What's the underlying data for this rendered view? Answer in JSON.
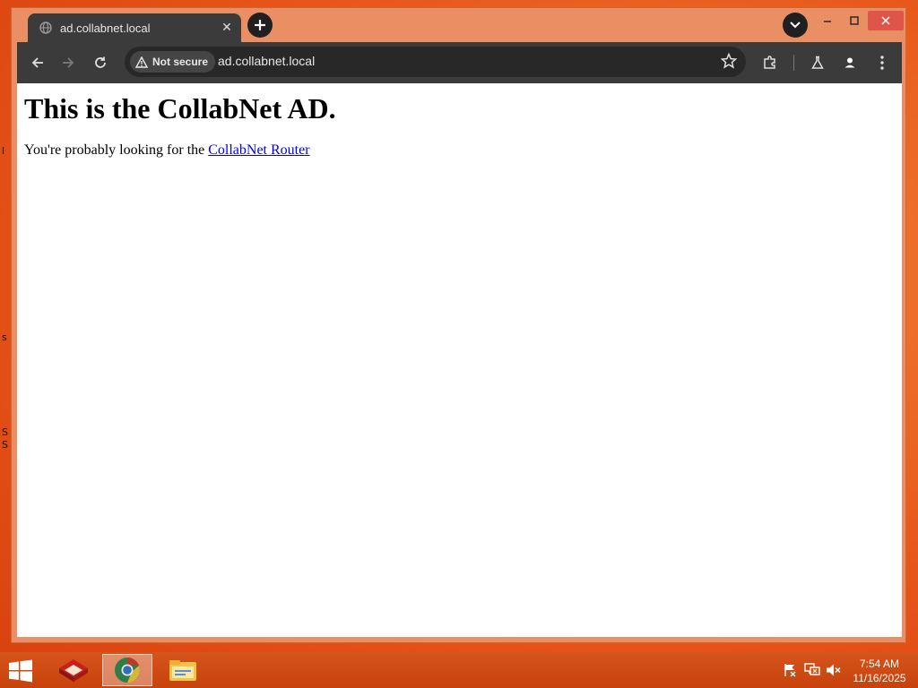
{
  "browser": {
    "tab": {
      "title": "ad.collabnet.local"
    },
    "address_bar": {
      "security_label": "Not secure",
      "url": "ad.collabnet.local"
    }
  },
  "page": {
    "heading": "This is the CollabNet AD.",
    "text_before_link": "You're probably looking for the ",
    "link_text": "CollabNet Router"
  },
  "desktop": {
    "fragments": [
      "l",
      "s",
      "S",
      "S"
    ]
  },
  "taskbar": {
    "apps": [
      "security-app-icon",
      "chrome-icon",
      "file-explorer-icon"
    ],
    "clock": {
      "time": "7:54 AM",
      "date": "11/16/2025"
    }
  },
  "colors": {
    "accent_link": "#0000ee",
    "window_frame": "#ea8f63",
    "toolbar": "#3b3b3b",
    "close_button": "#e0554a"
  }
}
